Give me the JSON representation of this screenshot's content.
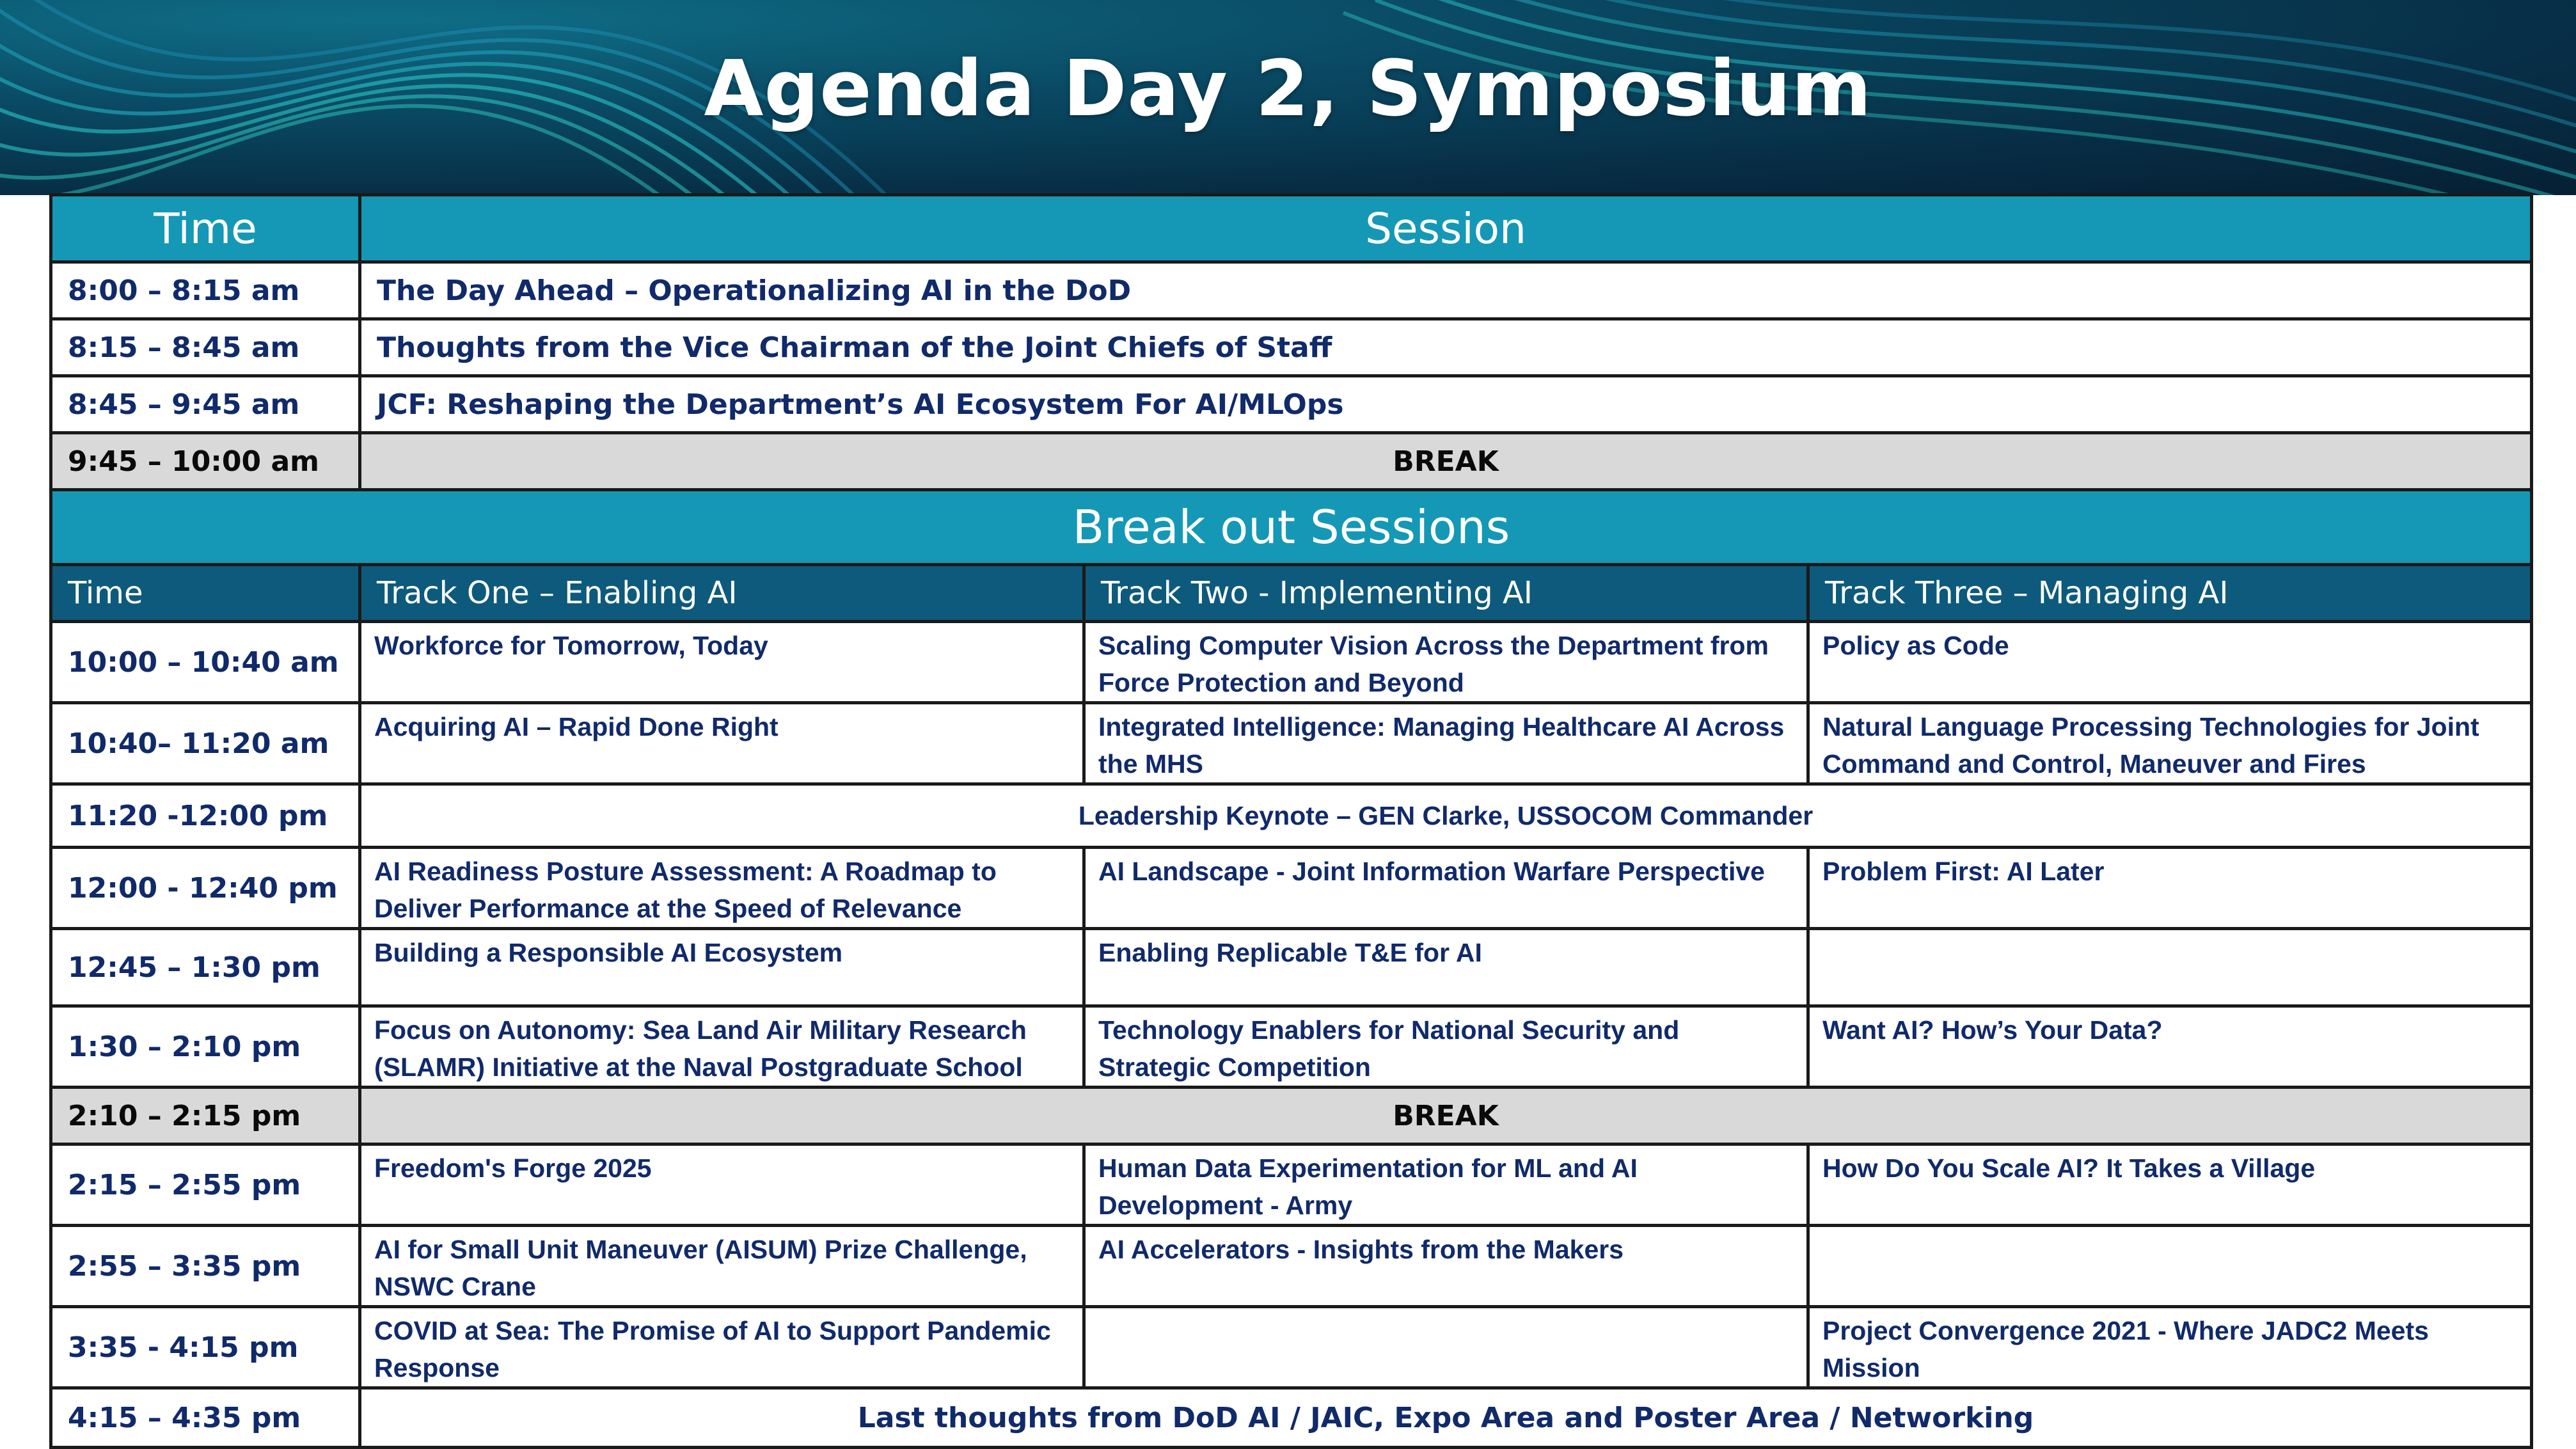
{
  "title": "Agenda Day 2, Symposium",
  "header": {
    "time": "Time",
    "session": "Session"
  },
  "plenary": [
    {
      "time": "8:00 – 8:15 am",
      "session": "The Day Ahead – Operationalizing AI in the DoD"
    },
    {
      "time": "8:15 – 8:45 am",
      "session": "Thoughts from the Vice Chairman of the Joint Chiefs of Staff"
    },
    {
      "time": "8:45 – 9:45 am",
      "session": "JCF: Reshaping the Department’s AI Ecosystem For AI/MLOps"
    }
  ],
  "break1": {
    "time": "9:45 – 10:00 am",
    "label": "BREAK"
  },
  "breakout_title": "Break out Sessions",
  "tracks": {
    "time": "Time",
    "one": "Track One – Enabling AI",
    "two": "Track Two - Implementing AI",
    "three": "Track Three – Managing AI"
  },
  "rows_a": [
    {
      "time": "10:00 – 10:40 am",
      "one": "Workforce for Tomorrow, Today",
      "two": "Scaling Computer Vision Across the Department from Force Protection and Beyond",
      "three": "Policy as Code"
    },
    {
      "time": "10:40– 11:20 am",
      "one": "Acquiring AI – Rapid Done Right",
      "two": "Integrated Intelligence: Managing Healthcare AI Across the MHS",
      "three": "Natural Language Processing Technologies for Joint Command and Control, Maneuver and Fires"
    }
  ],
  "keynote": {
    "time": "11:20 -12:00 pm",
    "label": "Leadership Keynote – GEN Clarke, USSOCOM Commander"
  },
  "rows_b": [
    {
      "time": "12:00 - 12:40 pm",
      "one": "AI Readiness Posture Assessment: A Roadmap to Deliver Performance at the Speed of Relevance",
      "two": "AI Landscape - Joint Information Warfare Perspective",
      "three": "Problem First: AI Later"
    },
    {
      "time": "12:45 – 1:30 pm",
      "one": "Building a Responsible AI Ecosystem",
      "two": "Enabling Replicable T&E for AI",
      "three": ""
    },
    {
      "time": "1:30 – 2:10 pm",
      "one": "Focus on Autonomy: Sea Land Air Military Research (SLAMR) Initiative at the Naval Postgraduate School",
      "two": "Technology Enablers for National Security and Strategic Competition",
      "three": "Want AI? How’s Your Data?"
    }
  ],
  "break2": {
    "time": "2:10 – 2:15 pm",
    "label": "BREAK"
  },
  "rows_c": [
    {
      "time": "2:15 – 2:55 pm",
      "one": "Freedom's Forge 2025",
      "two": "Human Data Experimentation for ML and AI Development  - Army",
      "three": "How Do You Scale AI? It Takes a Village"
    },
    {
      "time": "2:55 – 3:35 pm",
      "one": "AI for Small Unit Maneuver (AISUM) Prize Challenge, NSWC Crane",
      "two": "AI Accelerators - Insights from the Makers",
      "three": ""
    },
    {
      "time": "3:35 - 4:15 pm",
      "one": "COVID at Sea: The Promise of AI to Support Pandemic Response",
      "two": "",
      "three": "Project Convergence 2021 - Where JADC2 Meets Mission"
    }
  ],
  "closing": {
    "time": "4:15 – 4:35 pm",
    "label": "Last thoughts from DoD AI  / JAIC, Expo Area and Poster Area / Networking"
  }
}
